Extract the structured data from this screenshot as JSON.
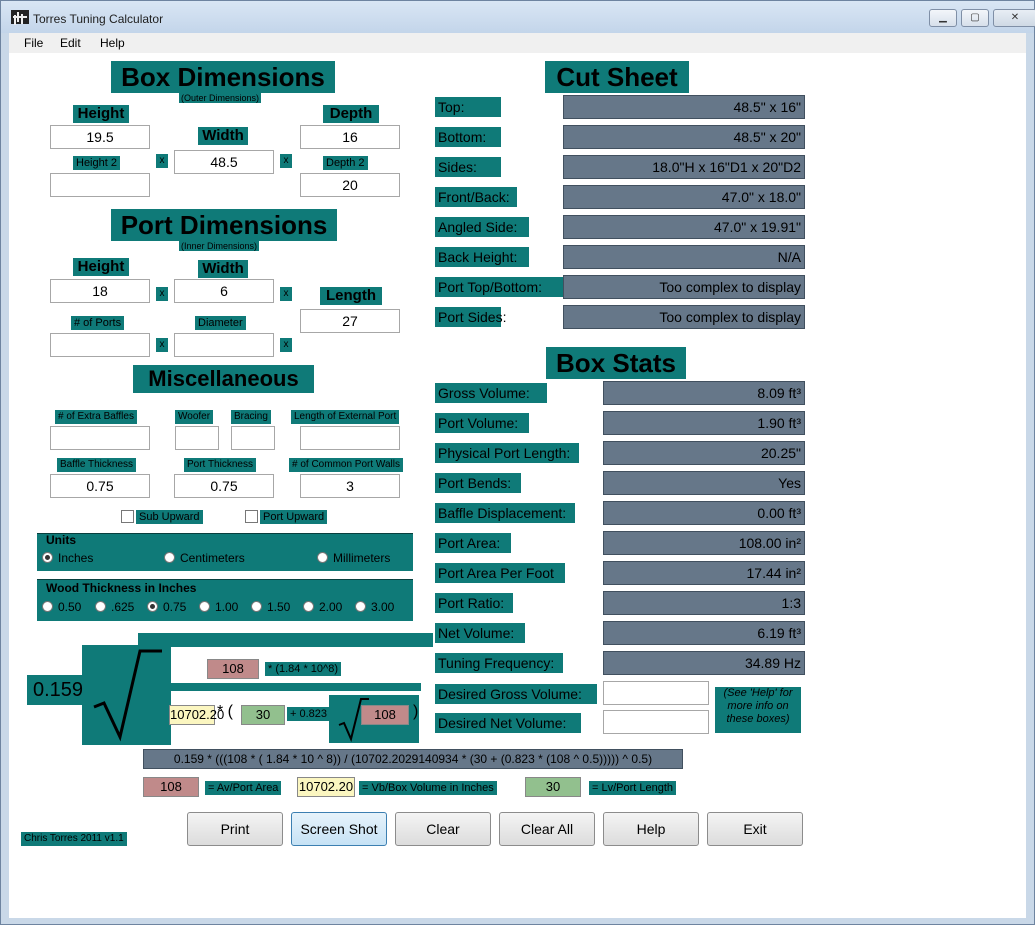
{
  "window": {
    "title": "Torres Tuning Calculator",
    "min": "▁",
    "max": "▢",
    "close": "✕",
    "icon": "waveform-icon"
  },
  "menu": [
    "File",
    "Edit",
    "Help"
  ],
  "box": {
    "title": "Box Dimensions",
    "subtitle": "(Outer Dimensions)",
    "height_label": "Height",
    "height": "19.5",
    "width_label": "Width",
    "width": "48.5",
    "depth_label": "Depth",
    "depth": "16",
    "height2_label": "Height 2",
    "height2": "",
    "depth2_label": "Depth 2",
    "depth2": "20",
    "x": "x"
  },
  "port": {
    "title": "Port Dimensions",
    "subtitle": "(Inner Dimensions)",
    "height_label": "Height",
    "height": "18",
    "width_label": "Width",
    "width": "6",
    "length_label": "Length",
    "length": "27",
    "ports_label": "# of Ports",
    "ports": "",
    "diameter_label": "Diameter",
    "diameter": ""
  },
  "misc": {
    "title": "Miscellaneous",
    "extra_baffles_label": "# of Extra Baffles",
    "extra_baffles": "",
    "woofer_label": "Woofer",
    "woofer": "",
    "bracing_label": "Bracing",
    "bracing": "",
    "ext_port_label": "Length of External Port",
    "ext_port": "",
    "baffle_thick_label": "Baffle Thickness",
    "baffle_thick": "0.75",
    "port_thick_label": "Port Thickness",
    "port_thick": "0.75",
    "common_walls_label": "# of Common Port Walls",
    "common_walls": "3",
    "sub_upward": "Sub Upward",
    "port_upward": "Port Upward"
  },
  "units": {
    "title": "Units",
    "options": [
      "Inches",
      "Centimeters",
      "Millimeters"
    ],
    "selected": "Inches"
  },
  "wood": {
    "title": "Wood Thickness in Inches",
    "options": [
      "0.50",
      ".625",
      "0.75",
      "1.00",
      "1.50",
      "2.00",
      "3.00"
    ],
    "selected": "0.75"
  },
  "formula": {
    "coef": "0.159",
    "av": "108",
    "mult": "* (1.84 * 10^8)",
    "vb": "10702.20",
    "open": "* (",
    "lv": "30",
    "plus": "+ 0.823",
    "av2": "108",
    "close": ")",
    "expression": "0.159 * (((108 * ( 1.84 * 10 ^ 8)) / (10702.2029140934 * (30 + (0.823 * (108 ^ 0.5))))) ^ 0.5)",
    "legend_av": "108",
    "legend_av_label": "= Av/Port Area",
    "legend_vb": "10702.20",
    "legend_vb_label": "= Vb/Box Volume in Inches",
    "legend_lv": "30",
    "legend_lv_label": "= Lv/Port Length",
    "colors": {
      "av": "#c08a8a",
      "vb": "#fbf6c0",
      "lv": "#92c08e"
    }
  },
  "cut": {
    "title": "Cut Sheet",
    "rows": [
      {
        "label": "Top:",
        "value": "48.5\" x 16\""
      },
      {
        "label": "Bottom:",
        "value": "48.5\" x 20\""
      },
      {
        "label": "Sides:",
        "value": "18.0\"H x 16\"D1 x 20\"D2"
      },
      {
        "label": "Front/Back:",
        "value": "47.0\" x 18.0\""
      },
      {
        "label": "Angled Side:",
        "value": "47.0\" x 19.91\""
      },
      {
        "label": "Back Height:",
        "value": "N/A"
      },
      {
        "label": "Port Top/Bottom:",
        "value": "Too complex to display"
      },
      {
        "label": "Port Sides:",
        "value": "Too complex to display"
      }
    ]
  },
  "stats": {
    "title": "Box Stats",
    "rows": [
      {
        "label": "Gross Volume:",
        "value": "8.09 ft³"
      },
      {
        "label": "Port Volume:",
        "value": "1.90 ft³"
      },
      {
        "label": "Physical Port Length:",
        "value": "20.25\""
      },
      {
        "label": "Port Bends:",
        "value": "Yes"
      },
      {
        "label": "Baffle Displacement:",
        "value": "0.00 ft³"
      },
      {
        "label": "Port Area:",
        "value": "108.00 in²"
      },
      {
        "label": "Port Area Per Foot",
        "value": "17.44 in²"
      },
      {
        "label": "Port Ratio:",
        "value": "1:3"
      },
      {
        "label": "Net Volume:",
        "value": "6.19 ft³"
      },
      {
        "label": "Tuning Frequency:",
        "value": "34.89 Hz"
      }
    ],
    "desired_gross_label": "Desired Gross Volume:",
    "desired_gross": "",
    "desired_net_label": "Desired Net Volume:",
    "desired_net": "",
    "hint": "(See 'Help' for more info on these boxes)"
  },
  "buttons": [
    "Print",
    "Screen Shot",
    "Clear",
    "Clear All",
    "Help",
    "Exit"
  ],
  "credit": "Chris Torres 2011 v1.1"
}
